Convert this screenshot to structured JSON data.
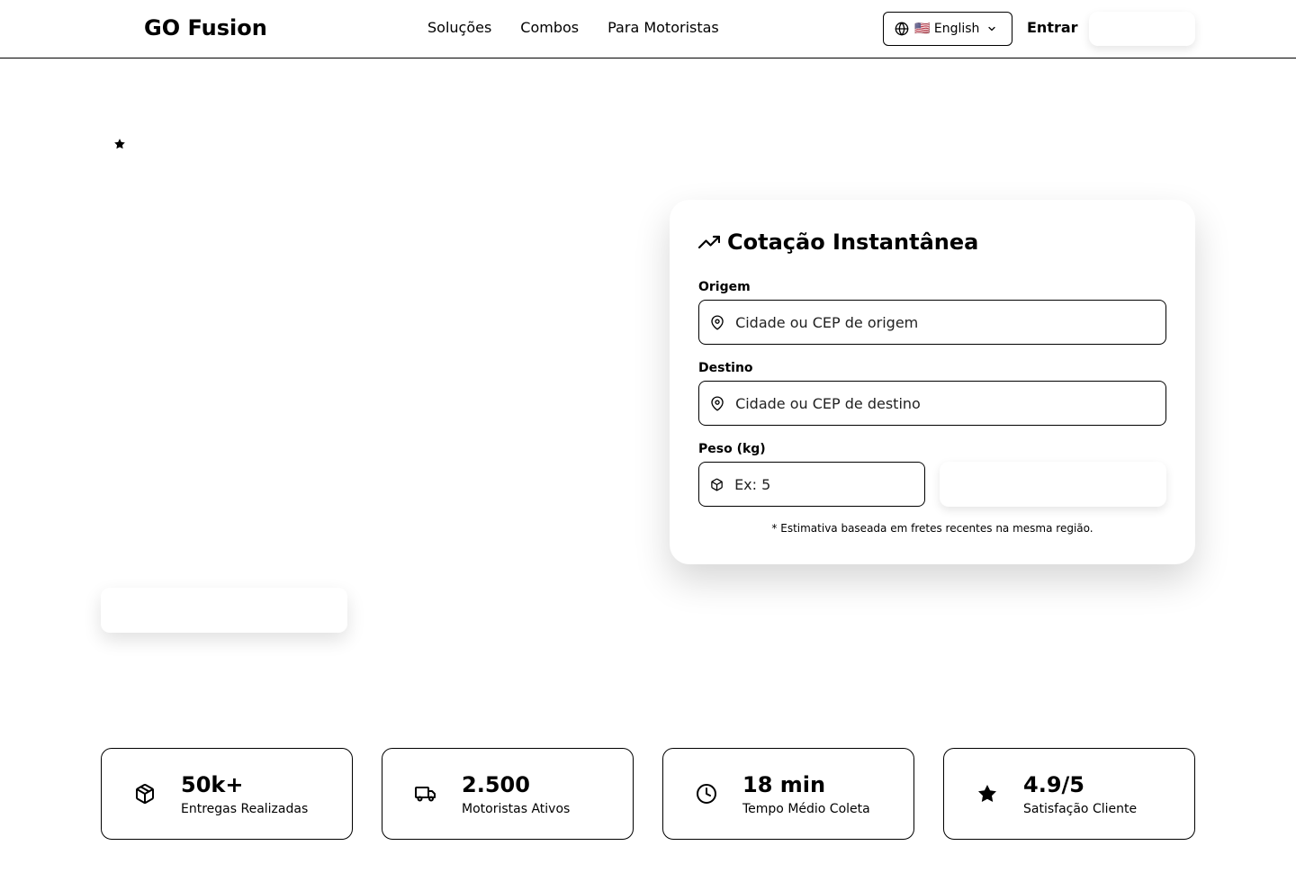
{
  "header": {
    "logo": "GO Fusion",
    "nav": [
      "Soluções",
      "Combos",
      "Para Motoristas"
    ],
    "language": "🇺🇸 English",
    "login": "Entrar"
  },
  "quote": {
    "title": "Cotação Instantânea",
    "origin": {
      "label": "Origem",
      "placeholder": "Cidade ou CEP de origem",
      "icon": "map-pin-icon"
    },
    "destination": {
      "label": "Destino",
      "placeholder": "Cidade ou CEP de destino",
      "icon": "map-pin-icon"
    },
    "weight": {
      "label": "Peso (kg)",
      "placeholder": "Ex: 5",
      "icon": "package-icon"
    },
    "note": "* Estimativa baseada em fretes recentes na mesma região."
  },
  "stats": [
    {
      "value": "50k+",
      "label": "Entregas Realizadas",
      "icon": "package-icon"
    },
    {
      "value": "2.500",
      "label": "Motoristas Ativos",
      "icon": "truck-icon"
    },
    {
      "value": "18 min",
      "label": "Tempo Médio Coleta",
      "icon": "clock-icon"
    },
    {
      "value": "4.9/5",
      "label": "Satisfação Cliente",
      "icon": "star-icon"
    }
  ]
}
